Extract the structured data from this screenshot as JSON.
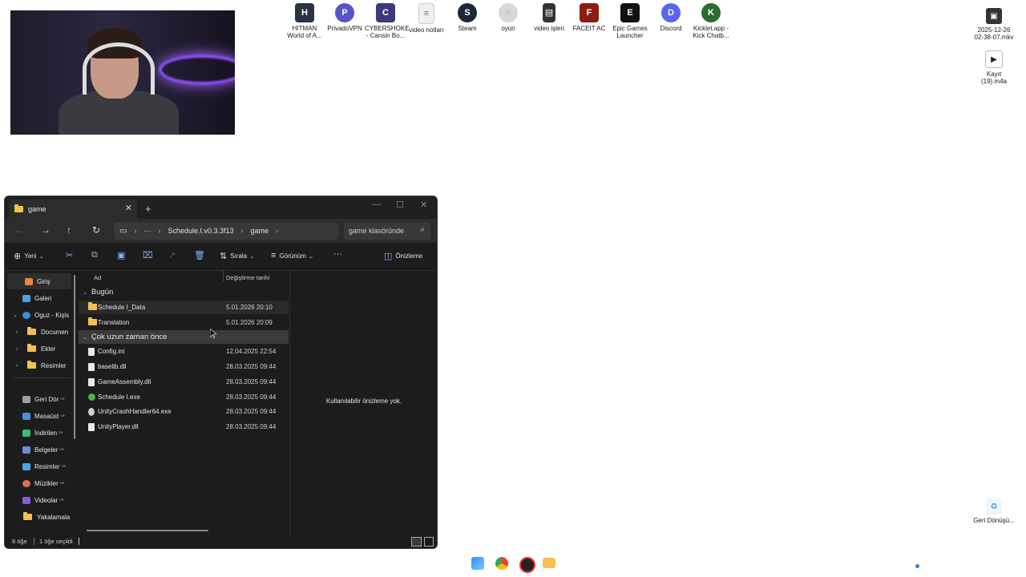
{
  "desktop": {
    "icons": [
      {
        "label": "HITMAN World of A...",
        "icon": "hitman-icon",
        "color": "#2a3344",
        "glyph": "H"
      },
      {
        "label": "PrivadoVPN",
        "icon": "vpn-icon",
        "color": "#5a52c8",
        "glyph": "P"
      },
      {
        "label": "CYBERSHOKE - Cansin Bo...",
        "icon": "cybershoke-icon",
        "color": "#3b3a7a",
        "glyph": "C"
      },
      {
        "label": "video notları",
        "icon": "document-icon",
        "color": "#f0f0f0",
        "glyph": "≡"
      },
      {
        "label": "Steam",
        "icon": "steam-icon",
        "color": "#1b2838",
        "glyph": "S"
      },
      {
        "label": "oyun",
        "icon": "disc-icon",
        "color": "#d8d8d8",
        "glyph": "○"
      },
      {
        "label": "video işleri",
        "icon": "sd-card-icon",
        "color": "#333333",
        "glyph": "▤"
      },
      {
        "label": "FACEIT AC",
        "icon": "faceit-icon",
        "color": "#8c1d12",
        "glyph": "F"
      },
      {
        "label": "Epic Games Launcher",
        "icon": "epic-icon",
        "color": "#111111",
        "glyph": "E"
      },
      {
        "label": "Discord",
        "icon": "discord-icon",
        "color": "#5865f2",
        "glyph": "D"
      },
      {
        "label": "Kicklet.app - Kick Chatb...",
        "icon": "kicklet-icon",
        "color": "#2f6b2f",
        "glyph": "K"
      }
    ],
    "right_icons": [
      {
        "label": "2025-12-26 02-38-07.mkv",
        "icon": "video-file-icon"
      },
      {
        "label": "Kayıt (19).m4a",
        "icon": "audio-file-icon"
      },
      {
        "label": "Geri Dönüşü...",
        "icon": "recycle-bin-icon"
      }
    ]
  },
  "explorer": {
    "tab_title": "game",
    "tab_close": "✕",
    "new_tab": "+",
    "window_controls": {
      "minimize": "—",
      "maximize": "☐",
      "close": "✕"
    },
    "nav": {
      "back": "←",
      "forward": "→",
      "up": "↑",
      "refresh": "↻",
      "more": "···"
    },
    "breadcrumb": [
      "Schedule.I.v0.3.3f13",
      "game"
    ],
    "search_placeholder": "game klasöründe",
    "toolbar": {
      "new": "Yeni",
      "sort": "Sırala",
      "view": "Görünüm",
      "more": "···",
      "preview": "Önizleme"
    },
    "sidebar": [
      {
        "label": "Giriş",
        "icon": "home-icon",
        "color": "#e8834a",
        "selected": true
      },
      {
        "label": "Galeri",
        "icon": "gallery-icon",
        "color": "#4aa3e8"
      },
      {
        "label": "Oguz - Kişis",
        "icon": "onedrive-icon",
        "color": "#3c8fe0",
        "expanded": true
      },
      {
        "label": "Documen",
        "icon": "folder-icon",
        "color": "#f2c14e"
      },
      {
        "label": "Ekler",
        "icon": "folder-icon",
        "color": "#f2c14e"
      },
      {
        "label": "Resimler",
        "icon": "folder-icon",
        "color": "#f2c14e"
      },
      {
        "label": "Geri Dör",
        "icon": "recycle-icon",
        "color": "#9aa0a6",
        "pinned": true
      },
      {
        "label": "Masaüst",
        "icon": "desktop-icon",
        "color": "#4a90e2",
        "pinned": true
      },
      {
        "label": "İndirilen",
        "icon": "download-icon",
        "color": "#3cba78",
        "pinned": true
      },
      {
        "label": "Belgeler",
        "icon": "documents-icon",
        "color": "#6b8ed6",
        "pinned": true
      },
      {
        "label": "Resimler",
        "icon": "pictures-icon",
        "color": "#4aa3e8",
        "pinned": true
      },
      {
        "label": "Müzikler",
        "icon": "music-icon",
        "color": "#e06a4f",
        "pinned": true
      },
      {
        "label": "Videolar",
        "icon": "videos-icon",
        "color": "#8a5ad8",
        "pinned": true
      },
      {
        "label": "Yakalamala",
        "icon": "folder-icon",
        "color": "#f2c14e"
      }
    ],
    "columns": {
      "name": "Ad",
      "modified": "Değiştirme tarihi"
    },
    "groups": [
      {
        "label": "Bugün",
        "items": [
          {
            "name": "Schedule I_Data",
            "date": "5.01.2026 20:10",
            "type": "folder"
          },
          {
            "name": "Translation",
            "date": "5.01.2026 20:09",
            "type": "folder"
          }
        ]
      },
      {
        "label": "Çok uzun zaman önce",
        "items": [
          {
            "name": "Config.ini",
            "date": "12.04.2025 22:54",
            "type": "file"
          },
          {
            "name": "baselib.dll",
            "date": "28.03.2025 09:44",
            "type": "file"
          },
          {
            "name": "GameAssembly.dll",
            "date": "28.03.2025 09:44",
            "type": "file"
          },
          {
            "name": "Schedule I.exe",
            "date": "28.03.2025 09:44",
            "type": "exe"
          },
          {
            "name": "UnityCrashHandler64.exe",
            "date": "28.03.2025 09:44",
            "type": "file"
          },
          {
            "name": "UnityPlayer.dll",
            "date": "28.03.2025 09:44",
            "type": "file"
          }
        ]
      }
    ],
    "preview_message": "Kullanılabilir önizleme yok.",
    "status": {
      "count": "8 öğe",
      "selected": "1 öğe seçildi"
    }
  }
}
